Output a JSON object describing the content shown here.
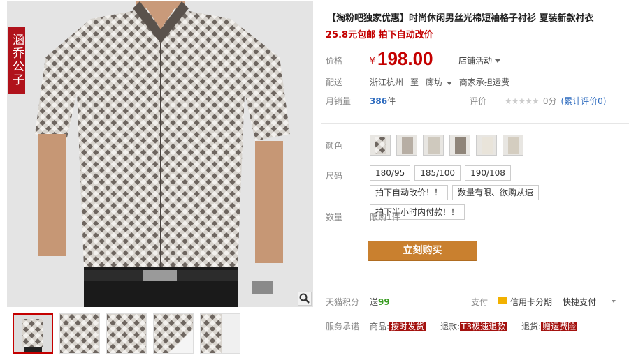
{
  "brand_tag": "涵乔公子",
  "title": "【淘粉吧独家优惠】时尚休闲男丝光棉短袖格子衬衫 夏装新款衬衣",
  "promo": {
    "main": "25.8元包邮",
    "sub": "拍下自动改价"
  },
  "price": {
    "label": "价格",
    "currency": "¥",
    "value": "198.00",
    "activity": "店铺活动"
  },
  "shipping": {
    "label": "配送",
    "from": "浙江杭州",
    "to_word": "至",
    "to": "廊坊",
    "fee": "商家承担运费"
  },
  "sales": {
    "label": "月销量",
    "count": "386",
    "unit": "件",
    "rating_label": "评价",
    "stars": "★★★★★",
    "score": "0分",
    "reviews": "(累计评价0)"
  },
  "color": {
    "label": "颜色",
    "swatch_count": 6
  },
  "size": {
    "label": "尺码",
    "options": [
      "180/95",
      "185/100",
      "190/108",
      "拍下自动改价！！",
      "数量有限、欲购从速",
      "拍下半小时内付款！！"
    ]
  },
  "quantity": {
    "label": "数量",
    "limit": "限购1件"
  },
  "buy_button": "立刻购买",
  "points": {
    "label": "天猫积分",
    "text": "送",
    "value": "99"
  },
  "payment": {
    "label": "支付",
    "card": "信用卡分期",
    "fast": "快捷支付"
  },
  "service": {
    "label": "服务承诺",
    "item_label": "商品:",
    "item_pill": "按时发货",
    "refund_label": "退款:",
    "refund_pill": "T3极速退款",
    "ship_label": "退货:",
    "ship_pill": "赠运费险"
  },
  "colors": {
    "price": "#c40000",
    "buy": "#c9802f",
    "link": "#2f6cbf",
    "brand": "#b0121b"
  }
}
